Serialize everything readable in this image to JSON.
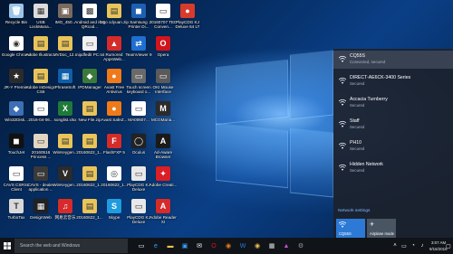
{
  "desktop": {
    "icons": [
      {
        "label": "Recycle Bin",
        "color": "#9cc4e8",
        "glyph": "🗑"
      },
      {
        "label": "USB LockMana...",
        "color": "#dcdcdc",
        "glyph": "▦"
      },
      {
        "label": "IMG_450...",
        "color": "#7a6a5e",
        "glyph": "▣"
      },
      {
        "label": "Android and iOS QRcod...",
        "color": "#ffffff",
        "glyph": "▩"
      },
      {
        "label": "logo cdyuan.zip",
        "color": "#e8c45a",
        "glyph": "▤"
      },
      {
        "label": "Samsung Printer Di...",
        "color": "#1e5fb3",
        "glyph": "◼"
      },
      {
        "label": "20160707 TED Conven...",
        "color": "#ffffff",
        "glyph": "▭"
      },
      {
        "label": "PlayCDG KJ Deluxe 64 LT",
        "color": "#d73b2c",
        "glyph": "●"
      },
      {
        "label": "Google Chrome",
        "color": "#ffffff",
        "glyph": "◉"
      },
      {
        "label": "Adobe Illustrat...",
        "color": "#e8c45a",
        "glyph": "▤"
      },
      {
        "label": "MVDoc_12...",
        "color": "#e8c45a",
        "glyph": "▤"
      },
      {
        "label": "mipdfedit PC.txt",
        "color": "#f0f0f0",
        "glyph": "▭"
      },
      {
        "label": "Rumored AppsWeb...",
        "color": "#d52b2b",
        "glyph": "▲"
      },
      {
        "label": "TeamViewer 9",
        "color": "#1f6fd0",
        "glyph": "⇄"
      },
      {
        "label": "Opera",
        "color": "#d0151d",
        "glyph": "O"
      },
      {
        "label": "JR-Y Premier",
        "color": "#2b2b2b",
        "glyph": "★"
      },
      {
        "label": "Adobe InDesign CS6",
        "color": "#e8c45a",
        "glyph": "▤"
      },
      {
        "label": "PhraseSoft",
        "color": "#0e5fa8",
        "glyph": "▦"
      },
      {
        "label": "IPDManager",
        "color": "#3a7a3a",
        "glyph": "◆"
      },
      {
        "label": "Avast Free Antivirus",
        "color": "#f07a1a",
        "glyph": "●"
      },
      {
        "label": "Touch screen keyboard o...",
        "color": "#6a6a6a",
        "glyph": "▭"
      },
      {
        "label": "OKI Mouse Interface",
        "color": "#5a5a5a",
        "glyph": "▭"
      },
      {
        "label": "Win32Disk...",
        "color": "#3d6fb4",
        "glyph": "◆"
      },
      {
        "label": "2016-04-06...",
        "color": "#ffffff",
        "glyph": "▭"
      },
      {
        "label": "songlist.xlsx",
        "color": "#1f7a3a",
        "glyph": "X"
      },
      {
        "label": "New File.zip",
        "color": "#e8c45a",
        "glyph": "▤"
      },
      {
        "label": "Avast SafeZ...",
        "color": "#f07a1a",
        "glyph": "●"
      },
      {
        "label": "MA00607...",
        "color": "#ffffff",
        "glyph": "▭"
      },
      {
        "label": "MCGMana...",
        "color": "#2b2b2b",
        "glyph": "M"
      },
      {
        "label": "TouchJet",
        "color": "#111111",
        "glyph": "◼"
      },
      {
        "label": "20160516 Princess ...",
        "color": "#e0d6c2",
        "glyph": "▭"
      },
      {
        "label": "WinKeygen...",
        "color": "#e8c45a",
        "glyph": "▤"
      },
      {
        "label": "20160622_1...",
        "color": "#e8c45a",
        "glyph": "▤"
      },
      {
        "label": "FlashFXP 5",
        "color": "#d52b2b",
        "glyph": "F"
      },
      {
        "label": "Oculus",
        "color": "#222222",
        "glyph": "◯"
      },
      {
        "label": "Ad-Aware Browser",
        "color": "#1a1a1a",
        "glyph": "A"
      },
      {
        "label": "CAVS CSRSL Client",
        "color": "#ffffff",
        "glyph": "▭"
      },
      {
        "label": "CAVS - dealer application ...",
        "color": "#3a3a3a",
        "glyph": "▭"
      },
      {
        "label": "WinKeygen...",
        "color": "#2b2b2b",
        "glyph": "V"
      },
      {
        "label": "20160622_1...",
        "color": "#e8c45a",
        "glyph": "▤"
      },
      {
        "label": "20160622_1...",
        "color": "#ffffff",
        "glyph": "◎"
      },
      {
        "label": "PlayCDG KJ Deluxe",
        "color": "#e8e8e8",
        "glyph": "▭"
      },
      {
        "label": "Adobe Creati...",
        "color": "#da1f26",
        "glyph": "✦"
      },
      {
        "label": "TurboTax",
        "color": "#d9d9d9",
        "glyph": "T"
      },
      {
        "label": "DesignWeb",
        "color": "#222222",
        "glyph": "▦"
      },
      {
        "label": "网易云音乐",
        "color": "#d52b2b",
        "glyph": "♫"
      },
      {
        "label": "20160622_1...",
        "color": "#e8c45a",
        "glyph": "▤"
      },
      {
        "label": "Skype",
        "color": "#1f9be0",
        "glyph": "S"
      },
      {
        "label": "PlayCDG KJ Deluxe",
        "color": "#e8e8e8",
        "glyph": "▭"
      },
      {
        "label": "Adobe Reader XI",
        "color": "#d52b2b",
        "glyph": "A"
      }
    ]
  },
  "network_flyout": {
    "networks": [
      {
        "name": "CQ55S",
        "status": "Connected, secured"
      },
      {
        "name": "DIRECT-AE6CK-3400 Series",
        "status": "Secured"
      },
      {
        "name": "Accacia Turnberry",
        "status": "Secured"
      },
      {
        "name": "Staff",
        "status": "Secured"
      },
      {
        "name": "PH10",
        "status": "Secured"
      },
      {
        "name": "Hidden Network",
        "status": "Secured"
      }
    ],
    "settings_link": "Network settings",
    "tiles": [
      {
        "label": "CQ55S",
        "icon": "wifi-icon",
        "color": "#2c7ad6"
      },
      {
        "label": "Airplane mode",
        "icon": "airplane-icon",
        "color": "#4a5563"
      }
    ]
  },
  "taskbar": {
    "search_placeholder": "Search the web and Windows",
    "time": "3:07 AM",
    "date": "9/16/2016"
  }
}
